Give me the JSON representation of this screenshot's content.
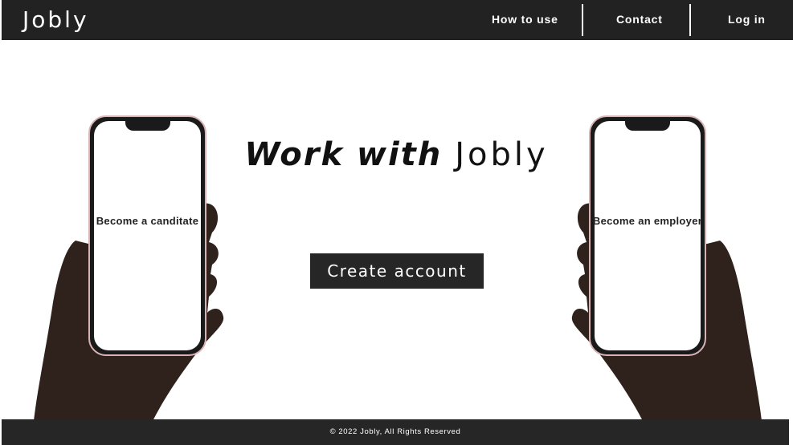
{
  "header": {
    "logo": "Jobly",
    "nav": {
      "how_to_use": "How to use",
      "contact": "Contact",
      "log_in": "Log in"
    }
  },
  "hero": {
    "title_part1": "Work with",
    "title_part2": "Jobly",
    "cta_label": "Create account"
  },
  "phones": {
    "left_label": "Become a canditate",
    "right_label": "Become an employer"
  },
  "footer": {
    "copyright": "© 2022 Jobly, All Rights Reserved"
  },
  "colors": {
    "nav_bg": "#222222",
    "footer_bg": "#262626",
    "cta_bg": "#262626",
    "page_bg": "#ffffff",
    "hand_skin": "#3a2a22"
  },
  "icons": {
    "left_hand": "hand-holding-phone-icon",
    "right_hand": "hand-holding-phone-icon"
  }
}
